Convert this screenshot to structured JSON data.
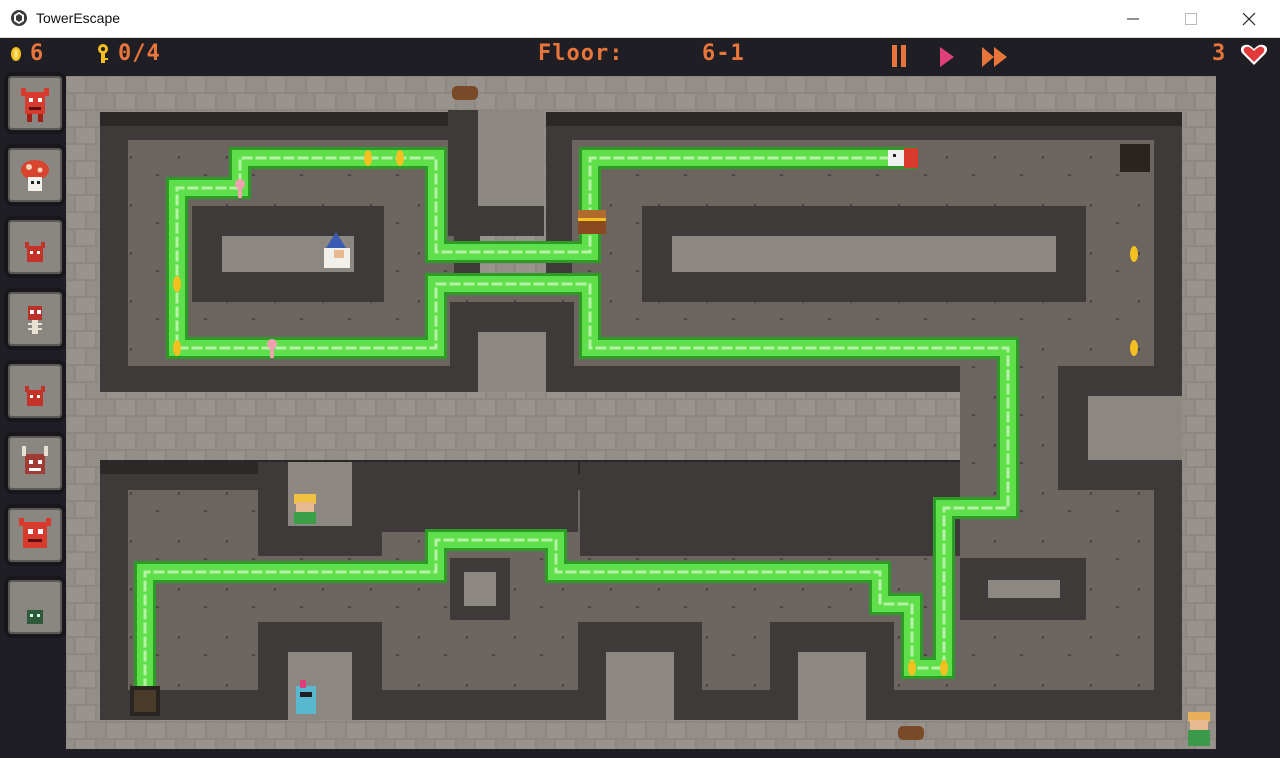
{
  "window": {
    "title": "TowerEscape",
    "controls": [
      "minimize",
      "maximize",
      "close"
    ]
  },
  "hud": {
    "coins": "6",
    "keys": "0/4",
    "floor_label": "Floor:",
    "floor_value": "6-1",
    "lives": "3",
    "buttons": [
      "pause",
      "play",
      "fast-forward"
    ],
    "accent_color": "#e8763a",
    "play_color": "#e0407a"
  },
  "sidebar": {
    "units": [
      "red-devil",
      "mushroom",
      "small-imp",
      "skeleton",
      "small-imp-2",
      "horned-demon",
      "red-devil-2",
      "green-zombie"
    ]
  },
  "colors": {
    "floor": "#6c6560",
    "wall_stone": "#8d8782",
    "wall_dark": "#3e3a3a",
    "path": "#5fe04a",
    "path_dark": "#2c9c27"
  },
  "board": {
    "entities": [
      "wizard",
      "elf-archer",
      "knight",
      "player",
      "chest",
      "red-worm"
    ],
    "coins_on_map": 8,
    "keys_on_map": 2
  }
}
